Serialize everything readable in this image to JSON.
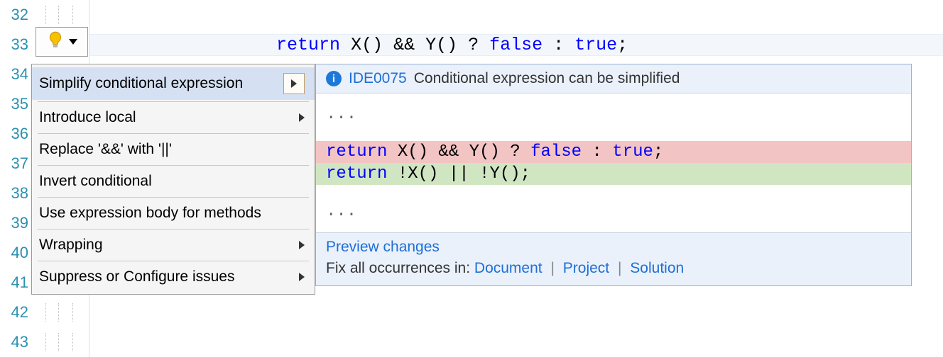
{
  "lines": {
    "l32": "32",
    "l33": "33",
    "l34": "34",
    "l35": "35",
    "l36": "36",
    "l37": "37",
    "l38": "38",
    "l39": "39",
    "l40": "40",
    "l41": "41",
    "l42": "42",
    "l43": "43"
  },
  "code": {
    "kw_return": "return",
    "mid": " X() && Y() ? ",
    "kw_false": "false",
    "colon": " : ",
    "kw_true": "true",
    "semi": ";"
  },
  "menu": {
    "items": [
      {
        "label": "Simplify conditional expression",
        "has_arrow": true,
        "selected": true
      },
      {
        "label": "Introduce local",
        "has_arrow": true,
        "selected": false
      },
      {
        "label": "Replace '&&' with '||'",
        "has_arrow": false,
        "selected": false
      },
      {
        "label": "Invert conditional",
        "has_arrow": false,
        "selected": false
      },
      {
        "label": "Use expression body for methods",
        "has_arrow": false,
        "selected": false
      },
      {
        "label": "Wrapping",
        "has_arrow": true,
        "selected": false
      },
      {
        "label": "Suppress or Configure issues",
        "has_arrow": true,
        "selected": false
      }
    ]
  },
  "preview": {
    "code": "IDE0075",
    "message": "Conditional expression can be simplified",
    "dots": "...",
    "diff_del": {
      "kw_return": "return",
      "mid": " X() && Y() ? ",
      "kw_false": "false",
      "colon": " : ",
      "kw_true": "true",
      "semi": ";"
    },
    "diff_add": {
      "kw_return": "return",
      "rest": " !X() || !Y();"
    },
    "preview_changes": "Preview changes",
    "fix_label": "Fix all occurrences in: ",
    "fix_document": "Document",
    "fix_project": "Project",
    "fix_solution": "Solution",
    "sep": "|"
  },
  "info_glyph": "i"
}
